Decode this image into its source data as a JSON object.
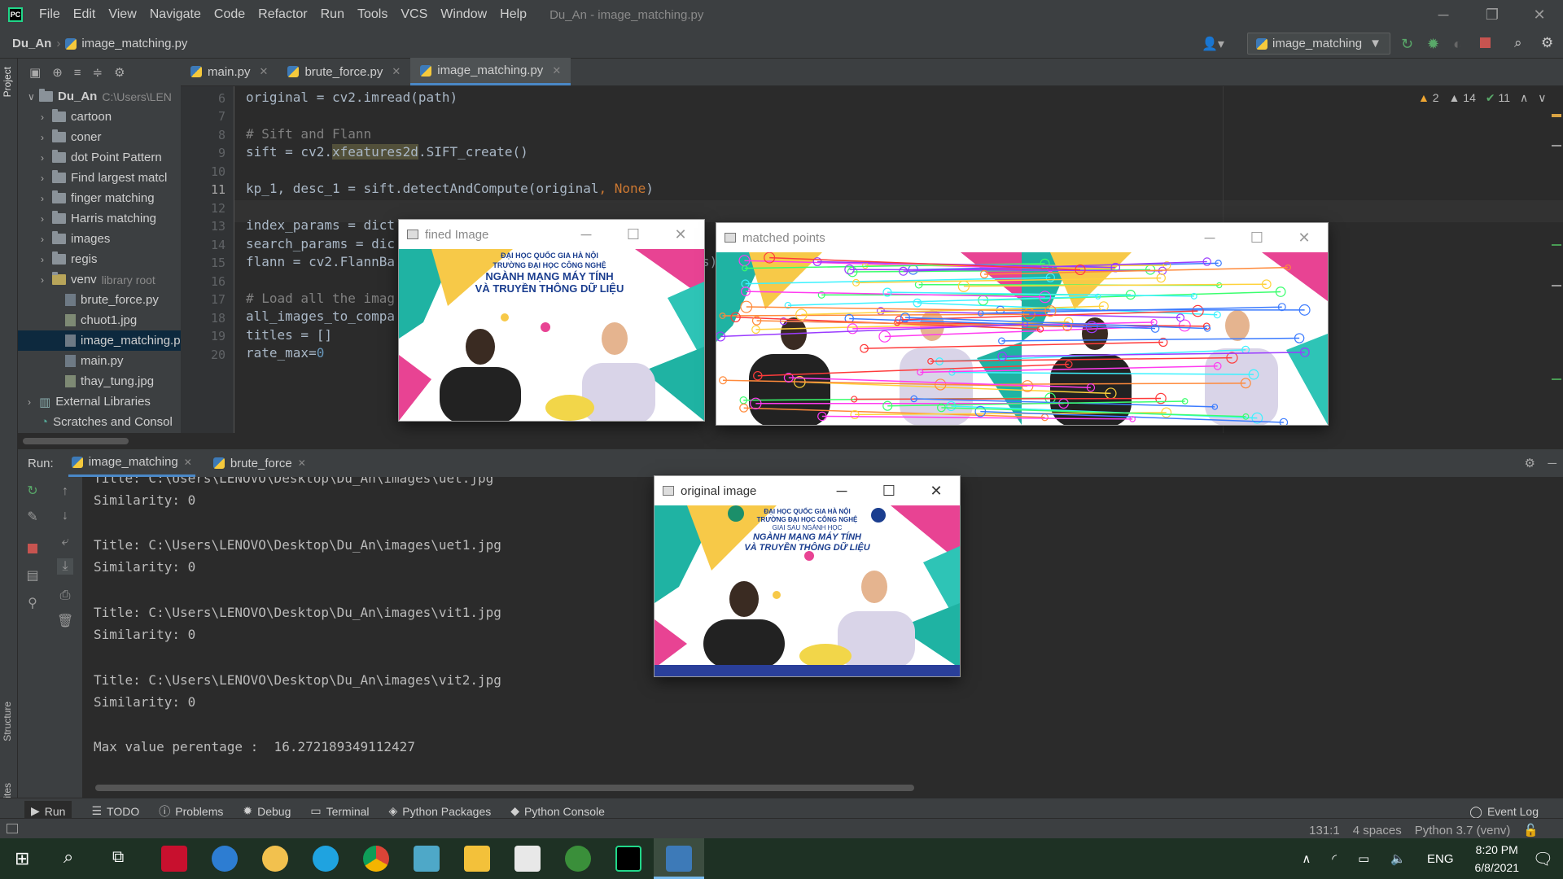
{
  "titlebar": {
    "menu": [
      "File",
      "Edit",
      "View",
      "Navigate",
      "Code",
      "Refactor",
      "Run",
      "Tools",
      "VCS",
      "Window",
      "Help"
    ],
    "window_title": "Du_An - image_matching.py"
  },
  "navbar": {
    "project": "Du_An",
    "file": "image_matching.py",
    "run_config": "image_matching"
  },
  "sidebar": {
    "project_label": "Project",
    "structure_label": "Structure",
    "favorites_label": "Favorites"
  },
  "project_tree": {
    "root": {
      "name": "Du_An",
      "path": "C:\\Users\\LEN"
    },
    "folders": [
      "cartoon",
      "coner",
      "dot Point Pattern",
      "Find largest matcl",
      "finger matching",
      "Harris matching",
      "images",
      "regis"
    ],
    "venv": {
      "name": "venv",
      "hint": "library root"
    },
    "files": [
      "brute_force.py",
      "chuot1.jpg",
      "image_matching.p",
      "main.py",
      "thay_tung.jpg"
    ],
    "external": "External Libraries",
    "scratches": "Scratches and Consol"
  },
  "editor": {
    "tabs": [
      "main.py",
      "brute_force.py",
      "image_matching.py"
    ],
    "inspections": {
      "warn_a": "2",
      "warn_b": "14",
      "ok": "11"
    },
    "line_numbers": [
      "6",
      "7",
      "8",
      "9",
      "10",
      "11",
      "12",
      "13",
      "14",
      "15",
      "16",
      "17",
      "18",
      "19",
      "20"
    ],
    "lines": {
      "l6": "original = cv2.imread(path)",
      "l8": "# Sift and Flann",
      "l9_a": "sift = cv2.",
      "l9_b": "xfeatures2d",
      "l9_c": ".SIFT_create()",
      "l11_a": "kp_1, desc_1 = sift.detectAndCompute(original",
      "l11_b": ", ",
      "l11_c": "None",
      "l11_d": ")",
      "l13": "index_params = dict",
      "l14": "search_params = dic",
      "l15": "flann = cv2.FlannBa",
      "l15_tail": "s)",
      "l17": "# Load all the imag",
      "l18": "all_images_to_compa",
      "l19": "titles = []",
      "l20_a": "rate_max=",
      "l20_b": "0"
    }
  },
  "run_panel": {
    "label": "Run:",
    "tabs": [
      "image_matching",
      "brute_force"
    ],
    "output": [
      "Title: C:\\Users\\LENOVO\\Desktop\\Du_An\\images\\uet.jpg",
      "Similarity: 0",
      "Title: C:\\Users\\LENOVO\\Desktop\\Du_An\\images\\uet1.jpg",
      "Similarity: 0",
      "Title: C:\\Users\\LENOVO\\Desktop\\Du_An\\images\\vit1.jpg",
      "Similarity: 0",
      "Title: C:\\Users\\LENOVO\\Desktop\\Du_An\\images\\vit2.jpg",
      "Similarity: 0",
      "Max value perentage :  16.272189349112427"
    ]
  },
  "bottom_tools": [
    "Run",
    "TODO",
    "Problems",
    "Debug",
    "Terminal",
    "Python Packages",
    "Python Console"
  ],
  "event_log": "Event Log",
  "status": {
    "position": "131:1",
    "indent": "4 spaces",
    "interpreter": "Python 3.7 (venv)"
  },
  "taskbar": {
    "lang": "ENG",
    "time": "8:20 PM",
    "date": "6/8/2021"
  },
  "windows": {
    "fined": {
      "title": "fined Image"
    },
    "matched": {
      "title": "matched points"
    },
    "original": {
      "title": "original image"
    }
  },
  "banner": {
    "line1": "ĐẠI HỌC QUỐC GIA HÀ NỘI",
    "line2": "TRƯỜNG ĐẠI HỌC CÔNG NGHỆ",
    "line3": "GIAI SAU NGÀNH HỌC",
    "line4": "NGÀNH MẠNG MÁY TÍNH",
    "line5": "VÀ TRUYỀN THÔNG DỮ LIỆU"
  },
  "colors": {
    "accent": "#4a88c7",
    "editor_bg": "#2b2b2b",
    "panel_bg": "#3c3f41"
  }
}
